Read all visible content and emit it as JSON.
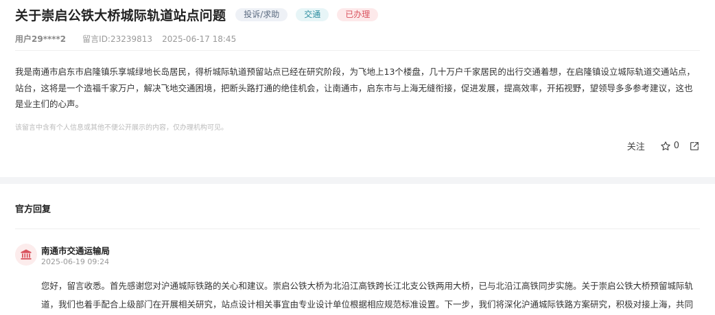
{
  "post": {
    "title": "关于崇启公铁大桥城际轨道站点问题",
    "tags": {
      "category": "投诉/求助",
      "topic": "交通",
      "status": "已办理"
    },
    "meta": {
      "user": "用户29****2",
      "message_id": "留言ID:23239813",
      "datetime": "2025-06-17 18:45"
    },
    "body": "我是南通市启东市启隆镇乐享城绿地长岛居民，得析城际轨道预留站点已经在研究阶段，为飞地上13个楼盘，几十万户千家居民的出行交通着想，在启隆镇设立城际轨道交通站点，站台，这将是一个造福千家万户，解决飞地交通困境，把断头路打通的绝佳机会，让南通市，启东市与上海无缝衔接，促进发展，提高效率，开拓视野，望领导多多参考建议，这也是业主们的心声。",
    "disclaimer": "该留言中含有个人信息或其他不便公开展示的内容，仅办理机构可见。",
    "actions": {
      "follow_label": "关注",
      "like_count": "0"
    }
  },
  "official_reply": {
    "heading": "官方回复",
    "org_name": "南通市交通运输局",
    "datetime": "2025-06-19 09:24",
    "text": "您好，留言收悉。首先感谢您对沪通城际铁路的关心和建议。崇启公铁大桥为北沿江高铁跨长江北支公铁两用大桥，已与北沿江高铁同步实施。关于崇启公铁大桥预留城际轨道，我们也着手配合上级部门在开展相关研究，站点设计相关事宜由专业设计单位根据相应规范标准设置。下一步，我们将深化沪通城际铁路方案研究，积极对接上海，共同"
  },
  "colors": {
    "status_tag_text": "#d9535e",
    "topic_tag_text": "#2f8ea0",
    "page_band": "#f3f4f6"
  },
  "icons": [
    "star-icon",
    "share-icon",
    "government-building-icon"
  ]
}
